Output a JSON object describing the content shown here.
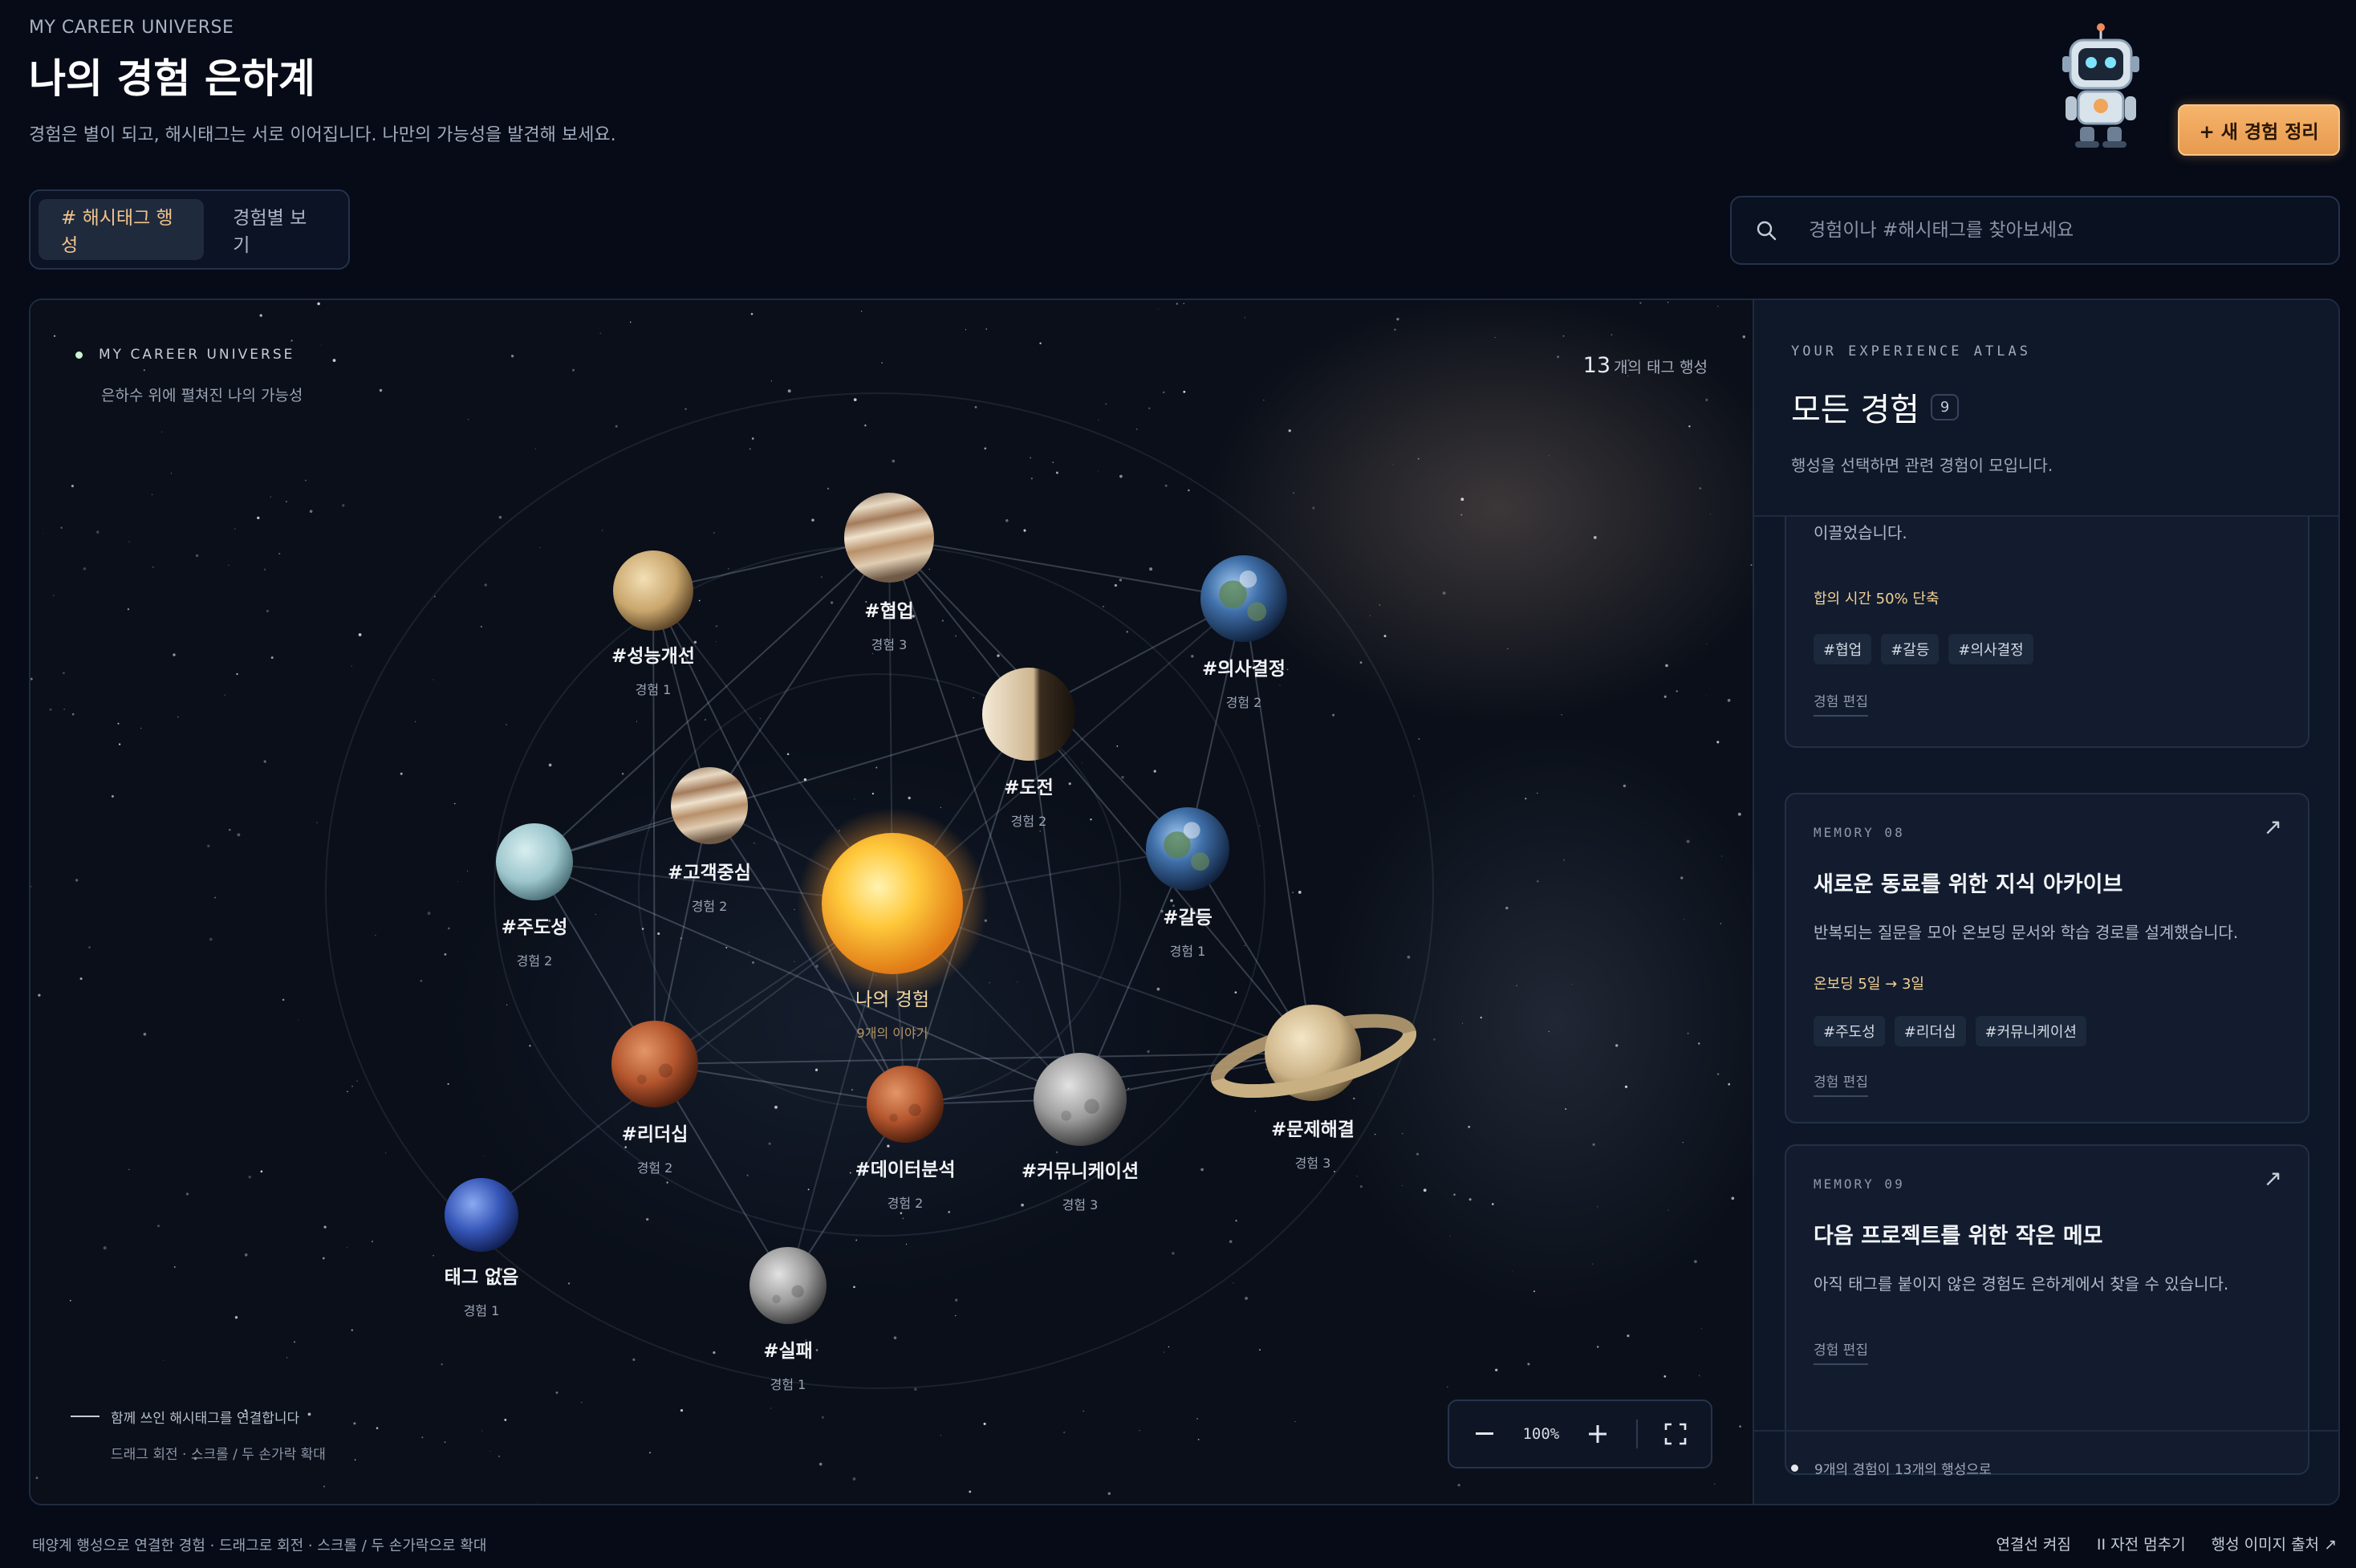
{
  "header": {
    "eyebrow": "MY CAREER UNIVERSE",
    "title": "나의 경험 은하계",
    "subtitle": "경험은 별이 되고, 해시태그는 서로 이어집니다. 나만의 가능성을 발견해 보세요.",
    "new_button": "+ 새 경험 정리"
  },
  "view_tabs": [
    {
      "label": "# 해시태그 행성",
      "active": true
    },
    {
      "label": "경험별 보기",
      "active": false
    }
  ],
  "search": {
    "placeholder": "경험이나 #해시태그를 찾아보세요",
    "value": ""
  },
  "galaxy": {
    "eyebrow": "MY CAREER UNIVERSE",
    "subtitle": "은하수 위에 펼쳐진 나의 가능성",
    "tag_count": "13",
    "tag_count_suffix": "개의 태그 행성",
    "legend_line": "함께 쓰인 해시태그를 연결합니다",
    "legend_hint": "드래그 회전 · 스크롤 / 두 손가락 확대",
    "zoom_level": "100%",
    "center": {
      "name": "나의 경험",
      "count": "9개의 이야기"
    },
    "nodes": [
      {
        "id": "cooperation",
        "name": "#협업",
        "count": "경험 3",
        "style": "jupiter"
      },
      {
        "id": "performance",
        "name": "#성능개선",
        "count": "경험 1",
        "style": "venus"
      },
      {
        "id": "decision",
        "name": "#의사결정",
        "count": "경험 2",
        "style": "earth"
      },
      {
        "id": "challenge",
        "name": "#도전",
        "count": "경험 2",
        "style": "moonphase"
      },
      {
        "id": "customer",
        "name": "#고객중심",
        "count": "경험 2",
        "style": "jupiter"
      },
      {
        "id": "initiative",
        "name": "#주도성",
        "count": "경험 2",
        "style": "uranus"
      },
      {
        "id": "conflict",
        "name": "#갈등",
        "count": "경험 1",
        "style": "earth"
      },
      {
        "id": "leadership",
        "name": "#리더십",
        "count": "경험 2",
        "style": "mars"
      },
      {
        "id": "data",
        "name": "#데이터분석",
        "count": "경험 2",
        "style": "mars"
      },
      {
        "id": "communication",
        "name": "#커뮤니케이션",
        "count": "경험 3",
        "style": "moon"
      },
      {
        "id": "problem",
        "name": "#문제해결",
        "count": "경험 3",
        "style": "saturn"
      },
      {
        "id": "untagged",
        "name": "태그 없음",
        "count": "경험 1",
        "style": "neptune"
      },
      {
        "id": "failure",
        "name": "#실패",
        "count": "경험 1",
        "style": "moon"
      }
    ]
  },
  "sidebar": {
    "eyebrow": "YOUR EXPERIENCE ATLAS",
    "title": "모든 경험",
    "count": "9",
    "description": "행성을 선택하면 관련 경험이 모입니다.",
    "partial_card": {
      "text": "서로 다른 관점을 문서로 정리하고, 공통의 판단 기준을 만들어 합의를 이끌었습니다.",
      "metric": "합의 시간 50% 단축",
      "tags": [
        "#협업",
        "#갈등",
        "#의사결정"
      ],
      "edit": "경험 편집"
    },
    "cards": [
      {
        "eyebrow": "MEMORY 08",
        "title": "새로운 동료를 위한 지식 아카이브",
        "text": "반복되는 질문을 모아 온보딩 문서와 학습 경로를 설계했습니다.",
        "metric": "온보딩 5일 → 3일",
        "tags": [
          "#주도성",
          "#리더십",
          "#커뮤니케이션"
        ],
        "edit": "경험 편집"
      },
      {
        "eyebrow": "MEMORY 09",
        "title": "다음 프로젝트를 위한 작은 메모",
        "text": "아직 태그를 붙이지 않은 경험도 은하계에서 찾을 수 있습니다.",
        "metric": "",
        "tags": [],
        "edit": "경험 편집"
      }
    ],
    "footer": "9개의 경험이 13개의 행성으로"
  },
  "footer": {
    "left": "태양계 행성으로 연결한 경험 · 드래그로 회전 · 스크롤 / 두 손가락으로 확대",
    "links": [
      "연결선 켜짐",
      "II 자전 멈추기",
      "행성 이미지 출처 ↗"
    ]
  },
  "colors": {
    "accent": "#f0a55a",
    "background": "#060b17",
    "panel": "#0e1727",
    "tag_text": "#d5dbe5"
  }
}
